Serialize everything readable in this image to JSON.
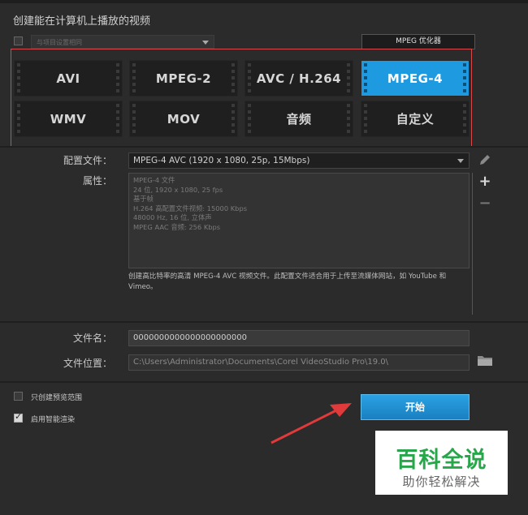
{
  "header": {
    "title": "创建能在计算机上播放的视频"
  },
  "project_option": {
    "label": "与项目设置相同",
    "checked": false
  },
  "optimizer_button": "MPEG 优化器",
  "formats": [
    {
      "label": "AVI",
      "active": false
    },
    {
      "label": "MPEG-2",
      "active": false
    },
    {
      "label": "AVC / H.264",
      "active": false
    },
    {
      "label": "MPEG-4",
      "active": true
    },
    {
      "label": "WMV",
      "active": false
    },
    {
      "label": "MOV",
      "active": false
    },
    {
      "label": "音频",
      "active": false
    },
    {
      "label": "自定义",
      "active": false
    }
  ],
  "profile": {
    "label": "配置文件：",
    "value": "MPEG-4 AVC (1920 x 1080, 25p, 15Mbps)"
  },
  "properties": {
    "label": "属性：",
    "lines": [
      "MPEG-4 文件",
      "24 位, 1920 x 1080, 25 fps",
      "基于帧",
      "H.264 高配置文件视频: 15000 Kbps",
      "48000 Hz, 16 位, 立体声",
      "MPEG AAC 音频: 256 Kbps"
    ],
    "description": "创建高比特率的高清 MPEG-4 AVC 视频文件。此配置文件适合用于上传至流媒体网站，如 YouTube 和 Vimeo。"
  },
  "file": {
    "name_label": "文件名：",
    "name_value": "0000000000000000000000",
    "location_label": "文件位置：",
    "location_value": "C:\\Users\\Administrator\\Documents\\Corel VideoStudio Pro\\19.0\\"
  },
  "options": [
    {
      "label": "只创建预览范围",
      "checked": false
    },
    {
      "label": "启用智能渲染",
      "checked": true
    }
  ],
  "start_button": "开始",
  "watermark": {
    "big": "百科全说",
    "small": "助你轻松解决"
  },
  "colors": {
    "accent": "#1e9be0",
    "annotation": "#e03a3a",
    "watermark_green": "#27a64a"
  }
}
